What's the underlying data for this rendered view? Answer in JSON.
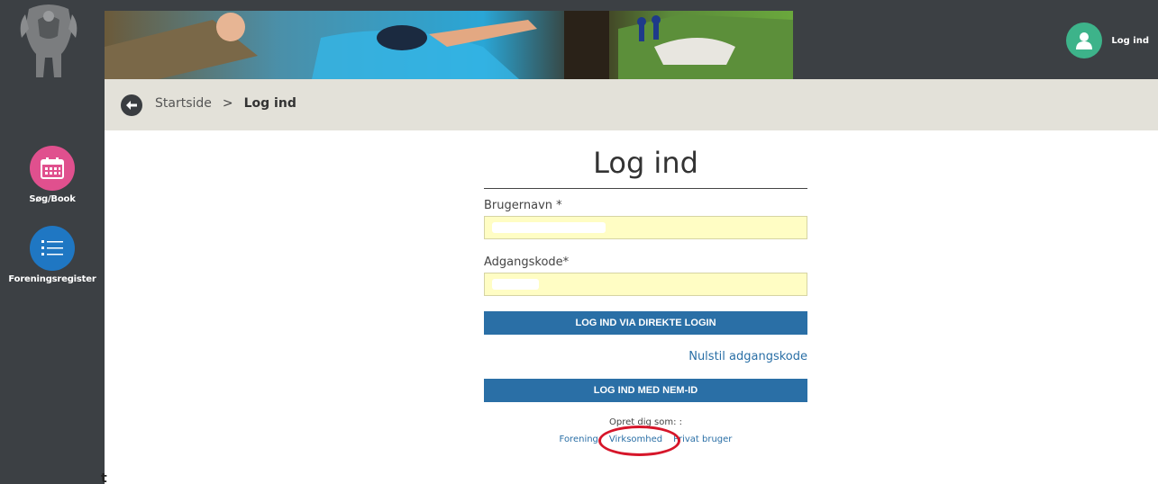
{
  "header": {
    "login_label": "Log ind"
  },
  "sidebar": {
    "items": [
      {
        "label": "Søg/Book",
        "color": "#e0508e"
      },
      {
        "label": "Foreningsregister",
        "color": "#1f77c3"
      }
    ]
  },
  "breadcrumb": {
    "home": "Startside",
    "separator": ">",
    "current": "Log ind"
  },
  "form": {
    "title": "Log ind",
    "username_label": "Brugernavn *",
    "password_label": "Adgangskode*",
    "direct_login_button": "LOG IND VIA DIREKTE LOGIN",
    "reset_link": "Nulstil adgangskode",
    "nemid_button": "LOG IND MED NEM-ID",
    "create_label": "Opret dig som: :",
    "roles": [
      "Forening",
      "Virksomhed",
      "Privat bruger"
    ]
  },
  "stray_text": "t",
  "colors": {
    "accent": "#2a6fa6",
    "sidebar": "#3c4044",
    "field_bg": "#fffdc4",
    "highlight": "#d6162a"
  }
}
